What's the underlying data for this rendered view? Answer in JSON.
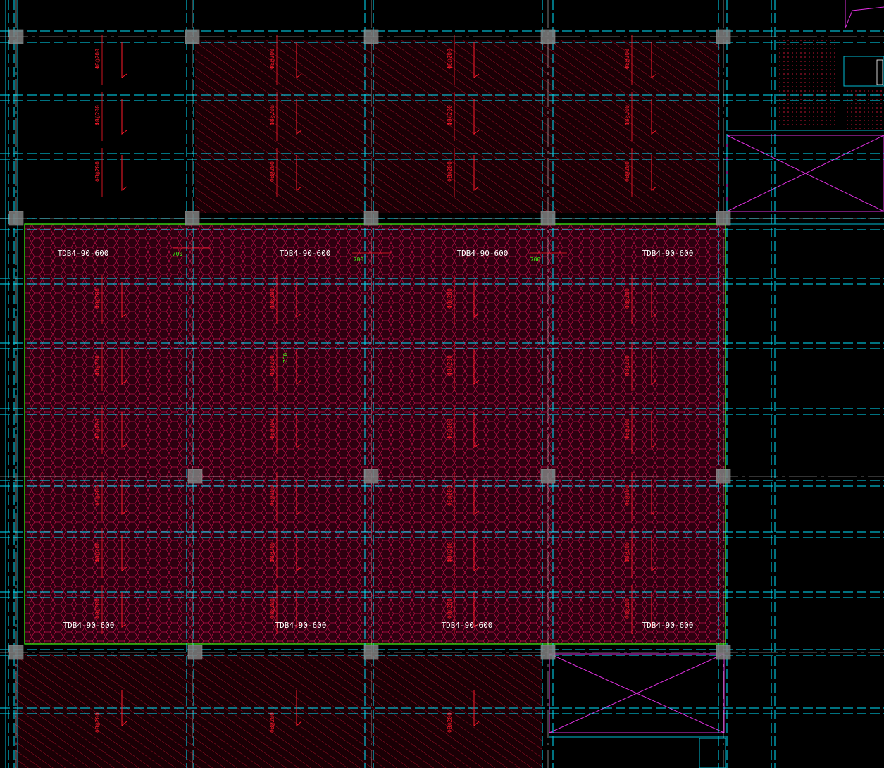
{
  "drawing": {
    "slab_panel_label": "TDB4-90-600",
    "rebar_label": "Φ8@200",
    "colors": {
      "background": "#000000",
      "axis_line": "#ffffff",
      "beam_dashed": "#00e5ff",
      "beam_solid": "#00bcd4",
      "hatch_red": "#c0102a",
      "hex_mesh": "#c0104a",
      "rebar": "#ff1a2a",
      "slab_border": "#39ff14",
      "dimension": "#39ff14",
      "opening_cross": "#e030e0",
      "column": "#808080"
    },
    "top_labels": [
      "TDB4-90-600",
      "TDB4-90-600",
      "TDB4-90-600",
      "TDB4-90-600"
    ],
    "bottom_labels": [
      "TDB4-90-600",
      "TDB4-90-600",
      "TDB4-90-600",
      "TDB4-90-600"
    ],
    "dimension_texts": [
      "700",
      "700",
      "700",
      "750"
    ],
    "top_rebar_labels": [
      "Φ8@200",
      "Φ8@200",
      "Φ8@200",
      "Φ8@200"
    ],
    "bottom_rebar_labels": [
      "Φ8@200",
      "Φ8@200",
      "Φ8@200"
    ]
  }
}
